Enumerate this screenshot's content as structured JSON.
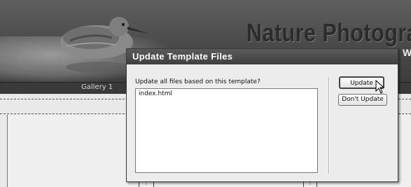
{
  "page": {
    "site_title": "Nature Photogra",
    "site_subtitle": "W",
    "nav": {
      "gallery_label": "Gallery 1"
    }
  },
  "dialog": {
    "title": "Update Template Files",
    "prompt": "Update all files based on this template?",
    "files": [
      "index.html"
    ],
    "buttons": {
      "update": "Update",
      "dont_update": "Don't Update"
    }
  },
  "colors": {
    "titlebar": "#4a4a4a",
    "dialog_bg": "#ececec",
    "banner": "#4f4f4f",
    "navbar": "#3a3a3a"
  },
  "icons": {
    "cursor": "arrow-cursor-icon"
  }
}
